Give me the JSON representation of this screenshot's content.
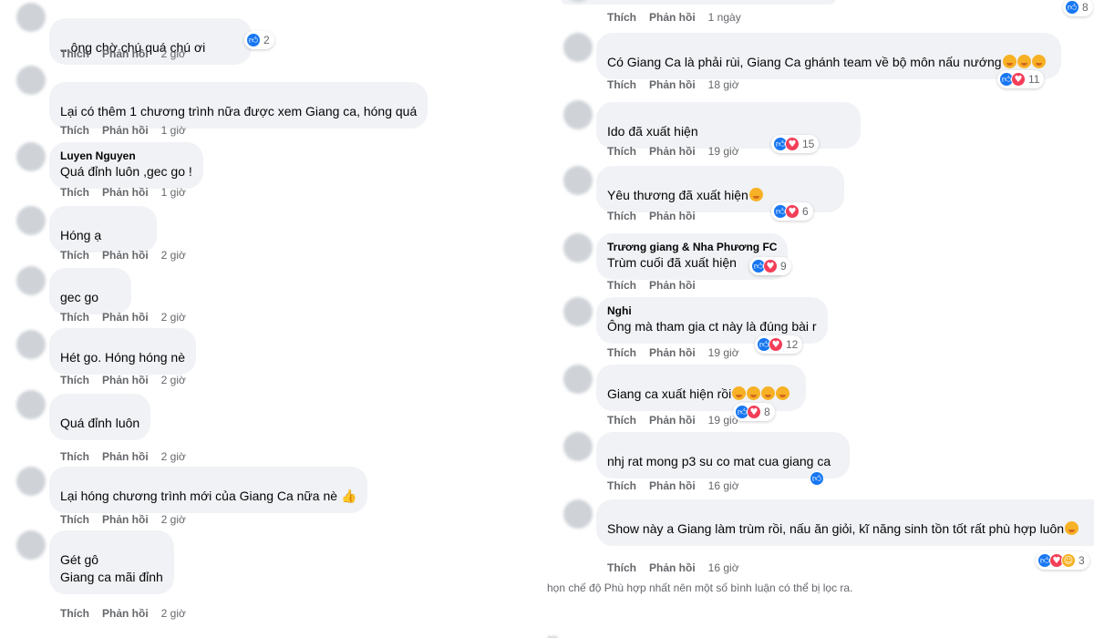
{
  "actions": {
    "like": "Thích",
    "reply": "Phản hồi"
  },
  "left": [
    {
      "text": "...ông chờ chú quá chú ơi",
      "time": "2 giờ",
      "react_count": "2",
      "reactions": [
        "like"
      ]
    },
    {
      "text": "Lại có thêm 1 chương trình nữa được xem Giang ca, hóng quá",
      "time": "1 giờ"
    },
    {
      "name": "Luyen Nguyen",
      "text": "Quá đỉnh luôn ,gec go !",
      "time": "1 giờ"
    },
    {
      "text": "Hóng ạ",
      "time": "2 giờ"
    },
    {
      "text": "gec go",
      "time": "2 giờ"
    },
    {
      "text": "Hét go. Hóng hóng nè",
      "time": "2 giờ"
    },
    {
      "text": "Quá đỉnh luôn",
      "time": "2 giờ"
    },
    {
      "text": "Lại hóng chương trình mới của Giang Ca nữa nè 👍",
      "time": "2 giờ"
    },
    {
      "text": "Gét gô",
      "text2": "Giang ca mãi đỉnh",
      "time": "2 giờ"
    }
  ],
  "right": [
    {
      "time": "1 ngày",
      "react_count": "8",
      "reactions": [
        "like"
      ]
    },
    {
      "text": "Có Giang Ca là phải rùi, Giang Ca ghánh team về bộ môn nấu nướng",
      "emoji_count": 3,
      "time": "18 giờ",
      "react_count": "11",
      "reactions": [
        "like",
        "love"
      ]
    },
    {
      "text": "Ido đã xuất hiện",
      "time": "19 giờ",
      "react_count": "15",
      "reactions": [
        "like",
        "love"
      ]
    },
    {
      "text": "Yêu thương đã xuất hiện",
      "emoji_count": 1,
      "time": "",
      "react_count": "6",
      "reactions": [
        "like",
        "love"
      ]
    },
    {
      "name": "Trương giang & Nha Phương FC",
      "text": "Trùm cuối đã xuất hiện",
      "time": "",
      "react_count": "9",
      "reactions": [
        "like",
        "love"
      ]
    },
    {
      "name": "Nghi",
      "text": "Ông mà tham gia ct này là đúng bài r",
      "time": "19 giờ",
      "react_count": "12",
      "reactions": [
        "like",
        "love"
      ]
    },
    {
      "text": "Giang ca xuất hiện rồi",
      "emoji_count": 4,
      "time": "19 giờ",
      "react_count": "8",
      "reactions": [
        "like",
        "love"
      ]
    },
    {
      "text": "nhj rat mong p3 su co mat cua giang ca",
      "time": "16 giờ",
      "reactions": [
        "like"
      ]
    },
    {
      "text": "Show này a Giang làm trùm rồi, nấu ăn giỏi, kĩ năng sinh tồn tốt rất phù hợp luôn",
      "emoji_count": 1,
      "time": "16 giờ",
      "react_count": "3",
      "reactions": [
        "like",
        "love",
        "care"
      ]
    }
  ],
  "filter_note": "họn chế độ Phù hợp nhất nên một số bình luận có thể bị lọc ra.",
  "colors": {
    "bubble": "#f0f2f5",
    "meta": "#65676b",
    "like": "#1877f2",
    "love": "#f33e58",
    "care": "#f7b125"
  }
}
